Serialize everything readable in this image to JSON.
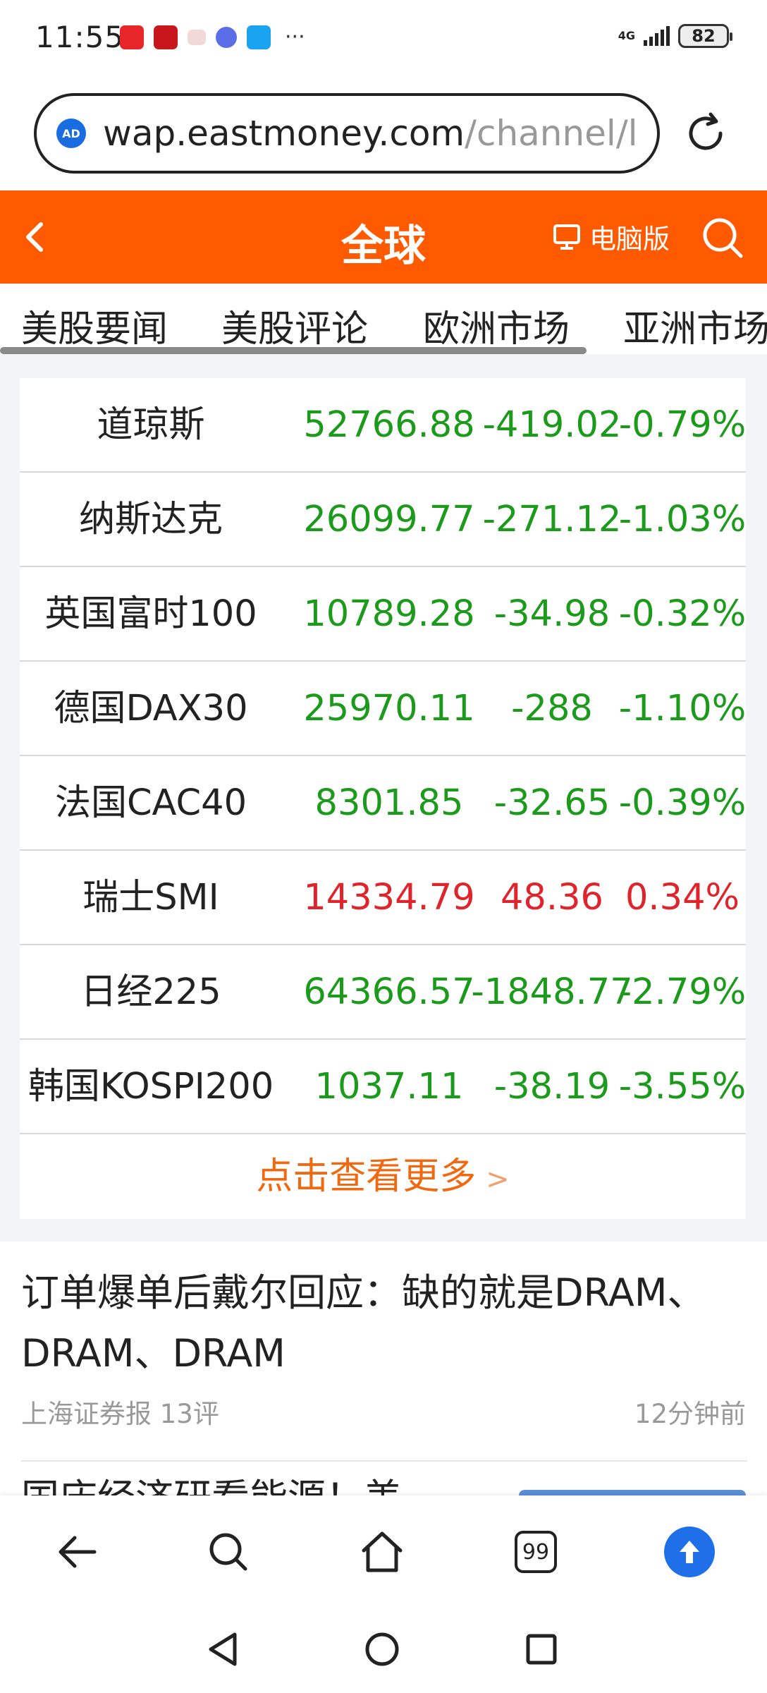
{
  "status_bar": {
    "time": "11:55",
    "network": "4G",
    "battery": "82",
    "more": "···"
  },
  "url_bar": {
    "badge": "AD",
    "domain": "wap.eastmoney.com",
    "path": "/channel/list"
  },
  "header": {
    "title": "全球",
    "pc_version_label": "电脑版"
  },
  "tabs": [
    {
      "label": "美股要闻"
    },
    {
      "label": "美股评论"
    },
    {
      "label": "欧洲市场"
    },
    {
      "label": "亚洲市场"
    }
  ],
  "market": {
    "rows": [
      {
        "name": "道琼斯",
        "price": "52766.88",
        "change": "-419.02",
        "pct": "-0.79%"
      },
      {
        "name": "纳斯达克",
        "price": "26099.77",
        "change": "-271.12",
        "pct": "-1.03%"
      },
      {
        "name": "英国富时100",
        "price": "10789.28",
        "change": "-34.98",
        "pct": "-0.32%"
      },
      {
        "name": "德国DAX30",
        "price": "25970.11",
        "change": "-288",
        "pct": "-1.10%"
      },
      {
        "name": "法国CAC40",
        "price": "8301.85",
        "change": "-32.65",
        "pct": "-0.39%"
      },
      {
        "name": "瑞士SMI",
        "price": "14334.79",
        "change": "48.36",
        "pct": "0.34%"
      },
      {
        "name": "日经225",
        "price": "64366.57",
        "change": "-1848.77",
        "pct": "-2.79%"
      },
      {
        "name": "韩国KOSPI200",
        "price": "1037.11",
        "change": "-38.19",
        "pct": "-3.55%"
      }
    ],
    "more_label": "点击查看更多",
    "colors": {
      "down": "#1b9a1b",
      "up": "#e0242c"
    }
  },
  "article": {
    "title": "订单爆单后戴尔回应：缺的就是DRAM、DRAM、DRAM",
    "source": "上海证券报",
    "comments": "13评",
    "time": "12分钟前"
  },
  "next_article": {
    "title_partial": "国庆经济研看能源！美"
  },
  "toolbar": {
    "tab_count": "99"
  },
  "colors": {
    "brand_orange": "#ff5a00",
    "link_orange": "#f06810",
    "accent_blue": "#1e6fe8"
  }
}
